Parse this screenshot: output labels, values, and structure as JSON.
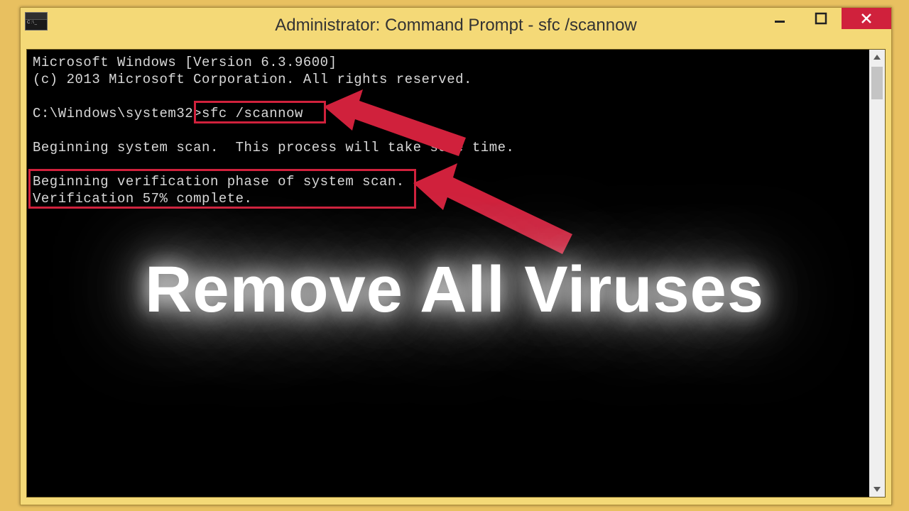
{
  "window": {
    "title": "Administrator: Command Prompt - sfc  /scannow"
  },
  "terminal": {
    "line1": "Microsoft Windows [Version 6.3.9600]",
    "line2": "(c) 2013 Microsoft Corporation. All rights reserved.",
    "blank1": "",
    "prompt_prefix": "C:\\Windows\\system32>",
    "command": "sfc /scannow",
    "blank2": "",
    "line4": "Beginning system scan.  This process will take some time.",
    "blank3": "",
    "line5": "Beginning verification phase of system scan.",
    "line6": "Verification 57% complete."
  },
  "overlay": {
    "caption": "Remove All Viruses"
  }
}
